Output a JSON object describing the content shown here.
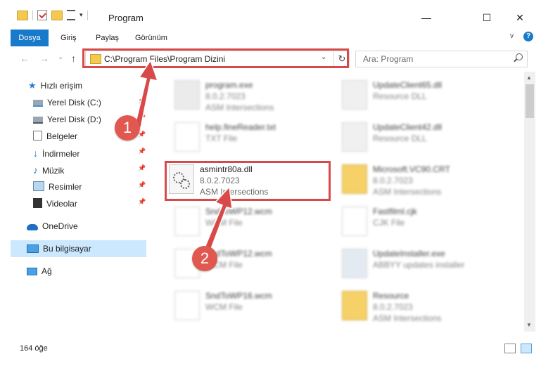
{
  "window": {
    "title": "Program",
    "minimize": "—",
    "maximize": "☐",
    "close": "✕"
  },
  "ribbon": {
    "tabs": [
      "Dosya",
      "Giriş",
      "Paylaş",
      "Görünüm"
    ],
    "help": "?",
    "expand": "v"
  },
  "nav": {
    "back": "←",
    "forward": "→",
    "recent": "⌄",
    "up": "↑"
  },
  "address": {
    "path": "C:\\Program Files\\Program Dizini",
    "dropdown": "⌄",
    "refresh": "↻"
  },
  "search": {
    "placeholder": "Ara: Program"
  },
  "sidebar": {
    "items": [
      {
        "label": "Hızlı erişim",
        "icon": "star-icon"
      },
      {
        "label": "Yerel Disk (C:)",
        "icon": "drive-icon"
      },
      {
        "label": "Yerel Disk (D:)",
        "icon": "drive-icon"
      },
      {
        "label": "Belgeler",
        "icon": "documents-icon"
      },
      {
        "label": "İndirmeler",
        "icon": "download-icon"
      },
      {
        "label": "Müzik",
        "icon": "music-icon"
      },
      {
        "label": "Resimler",
        "icon": "pictures-icon"
      },
      {
        "label": "Videolar",
        "icon": "video-icon"
      },
      {
        "label": "OneDrive",
        "icon": "cloud-icon"
      },
      {
        "label": "Bu bilgisayar",
        "icon": "computer-icon"
      },
      {
        "label": "Ağ",
        "icon": "network-icon"
      }
    ],
    "pin": "📌"
  },
  "files": [
    {
      "name": "program.exe",
      "line2": "8.0.2.7023",
      "line3": "ASM Intersections"
    },
    {
      "name": "UpdateClient65.dll",
      "line2": "Resource DLL",
      "line3": ""
    },
    {
      "name": "help.fineReader.txt",
      "line2": "TXT File",
      "line3": ""
    },
    {
      "name": "UpdateClient42.dll",
      "line2": "Resource DLL",
      "line3": ""
    },
    {
      "name": "asmintr80a.dll",
      "line2": "8.0.2.7023",
      "line3": "ASM Intersections"
    },
    {
      "name": "Microsoft.VC90.CRT",
      "line2": "8.0.2.7023",
      "line3": "ASM Intersections"
    },
    {
      "name": "SndToWP12.wcm",
      "line2": "WCM File",
      "line3": ""
    },
    {
      "name": "Fastfilml.cjk",
      "line2": "CJK File",
      "line3": ""
    },
    {
      "name": "SndToWP12.wcm",
      "line2": "WCM File",
      "line3": ""
    },
    {
      "name": "UpdateInstaller.exe",
      "line2": "ABBYY updates installer",
      "line3": ""
    },
    {
      "name": "SndToWP16.wcm",
      "line2": "WCM File",
      "line3": ""
    },
    {
      "name": "Resource",
      "line2": "8.0.2.7023",
      "line3": "ASM Intersections"
    }
  ],
  "status": {
    "count": "164 öğe"
  },
  "badges": {
    "one": "1",
    "two": "2"
  },
  "colors": {
    "accent": "#1979ca",
    "highlight": "#d84a4a",
    "selected": "#cce8ff"
  }
}
